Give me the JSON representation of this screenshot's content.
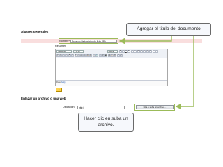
{
  "callouts": {
    "title_hint": "Agregar el titulo del documento",
    "upload_hint": "Hacer clic en suba un archivo."
  },
  "sections": {
    "general_title": "Ajustes generales",
    "web_title": "Enlazar un archivo o una web"
  },
  "form": {
    "name_label": "Nombre*",
    "name_value": "Proyecto Pedagógico de Aula PPA",
    "summary_label": "Resumen"
  },
  "editor": {
    "font_select": "Trebuchet",
    "size_select": "1 (8 pt)",
    "lang_select": "Idioma",
    "path_label": "Ruta:",
    "path_value": "body",
    "help_button": "?"
  },
  "upload": {
    "location_label": "Ubicación",
    "location_value": "http://",
    "button_label": "Elija o suba un archivo..."
  },
  "colors": {
    "accent": "#9bbb59",
    "pink_band": "#f9dede",
    "arrow": "#9bbb59"
  }
}
